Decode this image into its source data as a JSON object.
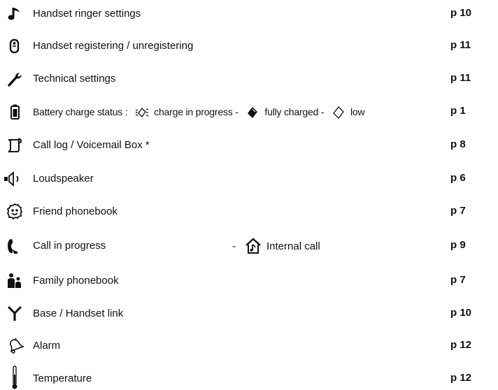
{
  "rows": [
    {
      "icon": "music-note-icon",
      "label": "Handset ringer settings",
      "page": "p 10"
    },
    {
      "icon": "handset-icon",
      "label": "Handset registering / unregistering",
      "page": "p 11"
    },
    {
      "icon": "wrench-icon",
      "label": "Technical settings",
      "page": "p 11"
    },
    {
      "icon": "battery-icon",
      "label_parts": [
        "Battery charge status : ",
        "charge in progress - ",
        "fully charged - ",
        "low"
      ],
      "page": "p 1"
    },
    {
      "icon": "call-log-icon",
      "label": "Call log / Voicemail Box *",
      "page": "p 8"
    },
    {
      "icon": "loudspeaker-icon",
      "label": "Loudspeaker",
      "page": "p 6"
    },
    {
      "icon": "friend-face-icon",
      "label": "Friend phonebook",
      "page": "p 7"
    },
    {
      "icon": "phone-icon",
      "label": "Call in progress",
      "extra_dash": "-",
      "extra_icon": "house-icon",
      "extra_label": "Internal call",
      "page": "p 9"
    },
    {
      "icon": "family-icon",
      "label": "Family phonebook",
      "page": "p 7"
    },
    {
      "icon": "antenna-icon",
      "label": "Base / Handset link",
      "page": "p 10"
    },
    {
      "icon": "bell-icon",
      "label": "Alarm",
      "page": "p 12"
    },
    {
      "icon": "thermometer-icon",
      "label": "Temperature",
      "page": "p 12"
    }
  ]
}
